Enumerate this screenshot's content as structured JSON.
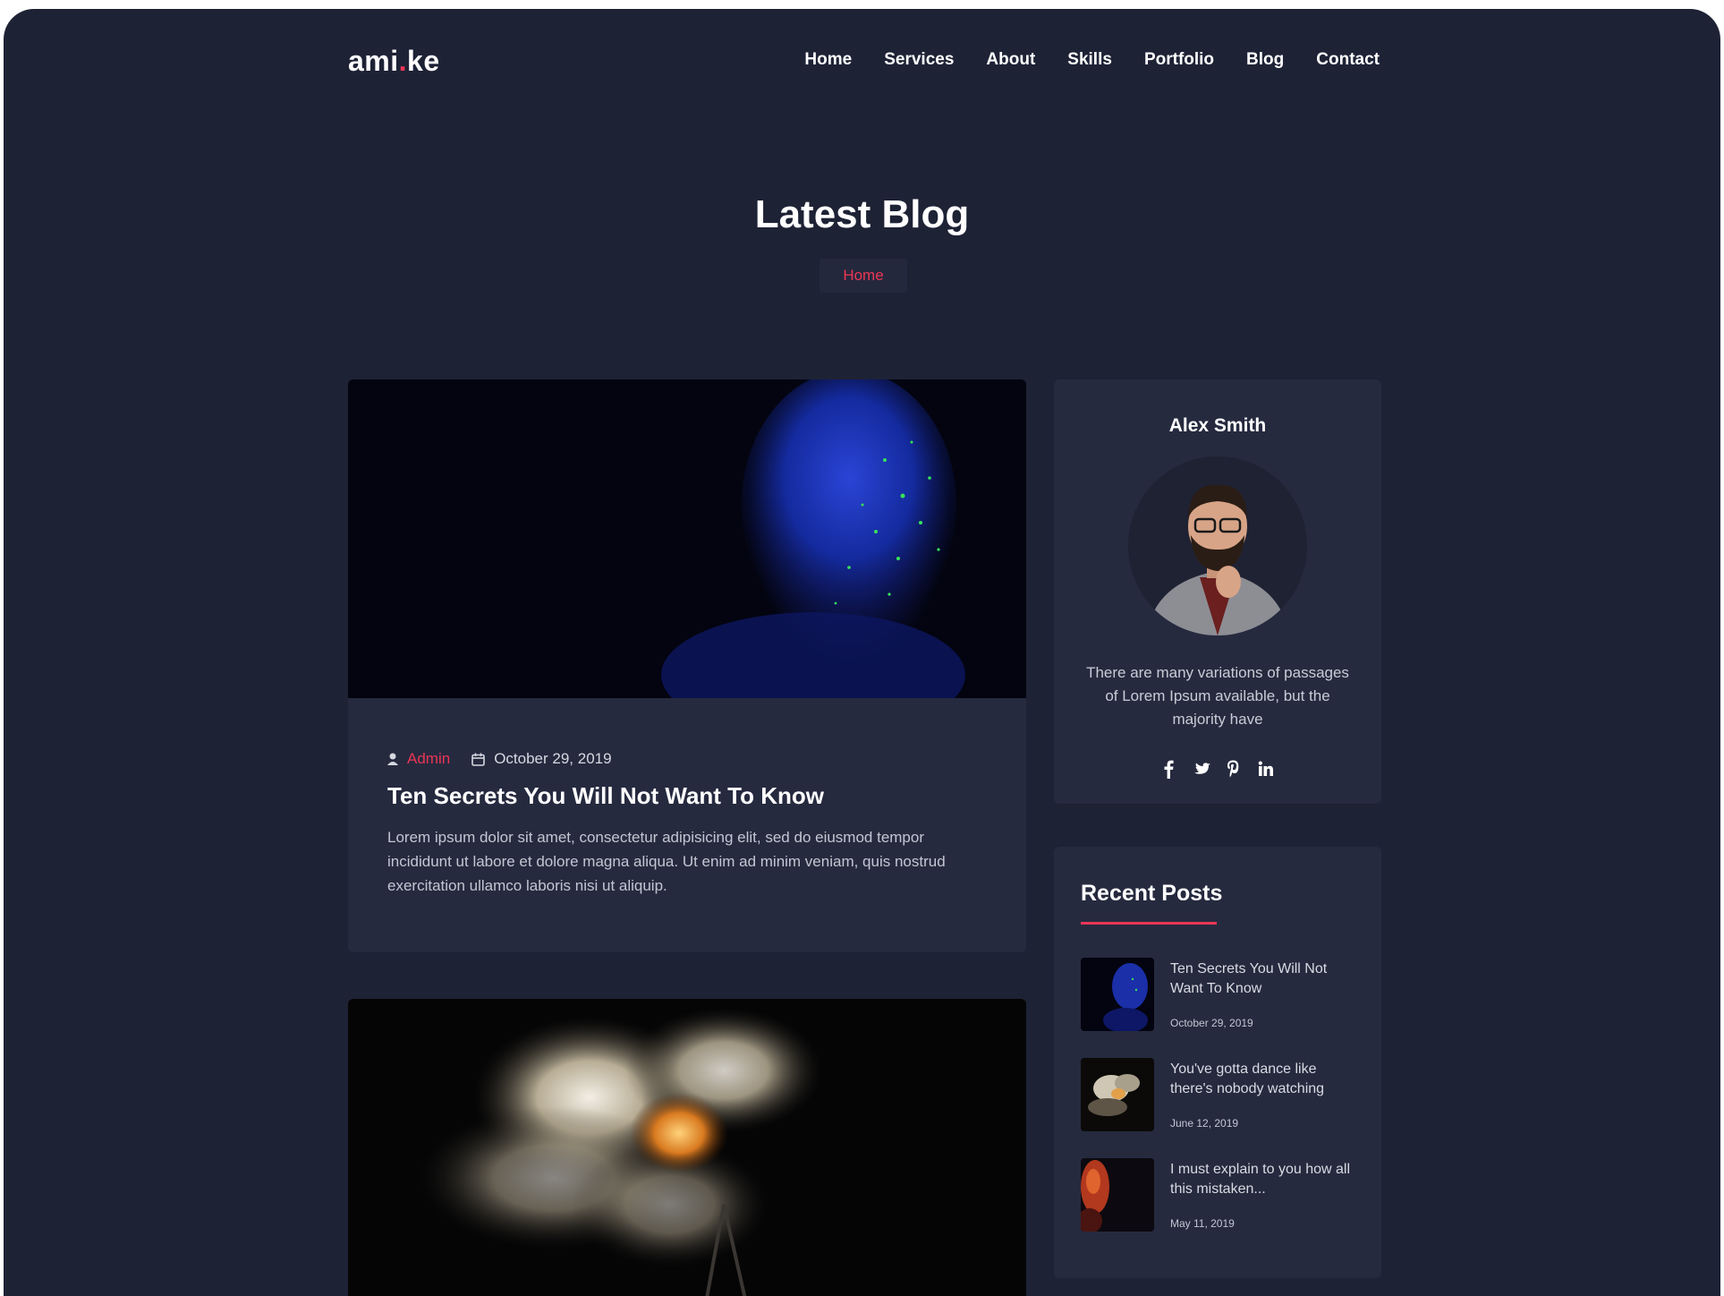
{
  "brand": {
    "name_a": "ami",
    "name_dot": ".",
    "name_b": "ke",
    "accent": "#ec3656",
    "bg": "#1e2235",
    "card": "#262a3f"
  },
  "nav": [
    "Home",
    "Services",
    "About",
    "Skills",
    "Portfolio",
    "Blog",
    "Contact"
  ],
  "hero": {
    "title": "Latest Blog",
    "breadcrumb": "Home"
  },
  "post": {
    "author": "Admin",
    "date": "October 29, 2019",
    "title": "Ten Secrets You Will Not Want To Know",
    "body": "Lorem ipsum dolor sit amet, consectetur adipisicing elit, sed do eiusmod tempor incididunt ut labore et dolore magna aliqua. Ut enim ad minim veniam, quis nostrud exercitation ullamco laboris nisi ut aliquip."
  },
  "profile": {
    "name": "Alex Smith",
    "bio": "There are many variations of passages of Lorem Ipsum available, but the majority have",
    "socials": [
      "facebook-icon",
      "twitter-icon",
      "pinterest-icon",
      "linkedin-icon"
    ]
  },
  "recent": {
    "title": "Recent Posts",
    "items": [
      {
        "title": "Ten Secrets You Will Not Want To Know",
        "date": "October 29, 2019"
      },
      {
        "title": "You've gotta dance like there's nobody watching",
        "date": "June 12, 2019"
      },
      {
        "title": "I must explain to you how all this mistaken...",
        "date": "May 11, 2019"
      }
    ]
  }
}
